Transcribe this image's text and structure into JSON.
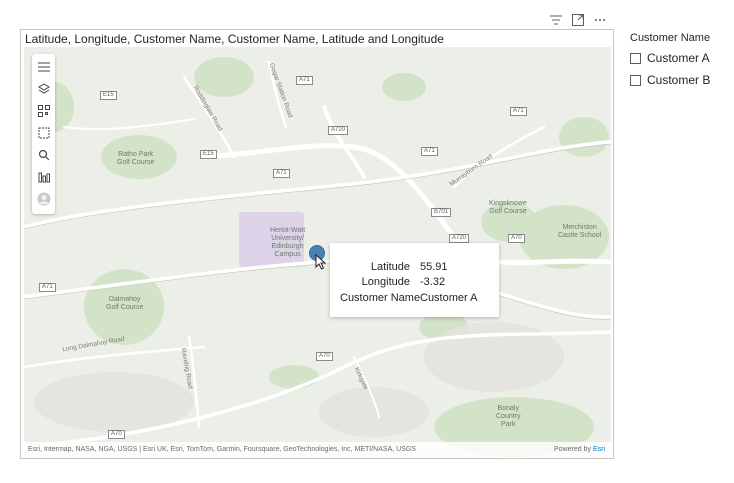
{
  "visual_header": {
    "icons": [
      "filter-icon",
      "focus-mode-icon",
      "more-options-icon"
    ]
  },
  "map": {
    "title": "Latitude, Longitude, Customer Name, Customer Name, Latitude and Longitude",
    "toolbar_icons": [
      "menu-icon",
      "layers-icon",
      "qr-icon",
      "select-icon",
      "search-icon",
      "chart-icon",
      "user-icon"
    ],
    "places": [
      "Ratho Park\nGolf Course",
      "Heriot-Watt\nUniversity/\nEdinburgh\nCampus",
      "Kingsknowe\nGolf Course",
      "Merchiston\nCastle School",
      "Dalmahoy\nGolf Course",
      "Bonaly\nCountry\nPark"
    ],
    "roads": [
      "E15",
      "E15",
      "A71",
      "A720",
      "A71",
      "A71",
      "A71",
      "B701",
      "A720",
      "A70",
      "A71",
      "A70",
      "A70"
    ],
    "road_names": [
      "Roddinglaw Road",
      "Gogar Station Road",
      "Murrayburn Road",
      "Long Dalmahoy Road",
      "Ravelrig Road",
      "Kirkgate"
    ],
    "tooltip": {
      "rows": [
        {
          "key": "Latitude",
          "value": "55.91"
        },
        {
          "key": "Longitude",
          "value": "-3.32"
        },
        {
          "key": "Customer Name",
          "value": "Customer A"
        }
      ]
    },
    "attribution": "Esri, Intermap, NASA, NGA, USGS | Esri UK, Esri, TomTom, Garmin, Foursquare, GeoTechnologies, Inc, METI/NASA, USGS",
    "powered_by_prefix": "Powered by",
    "powered_by_link": "Esri",
    "colors": {
      "pin": "#4a7fb0",
      "green": "#cfe1c4",
      "road": "#ffffff",
      "campus": "#d9d2e6"
    }
  },
  "slicer": {
    "title": "Customer Name",
    "items": [
      {
        "label": "Customer A",
        "checked": false
      },
      {
        "label": "Customer B",
        "checked": false
      }
    ]
  }
}
